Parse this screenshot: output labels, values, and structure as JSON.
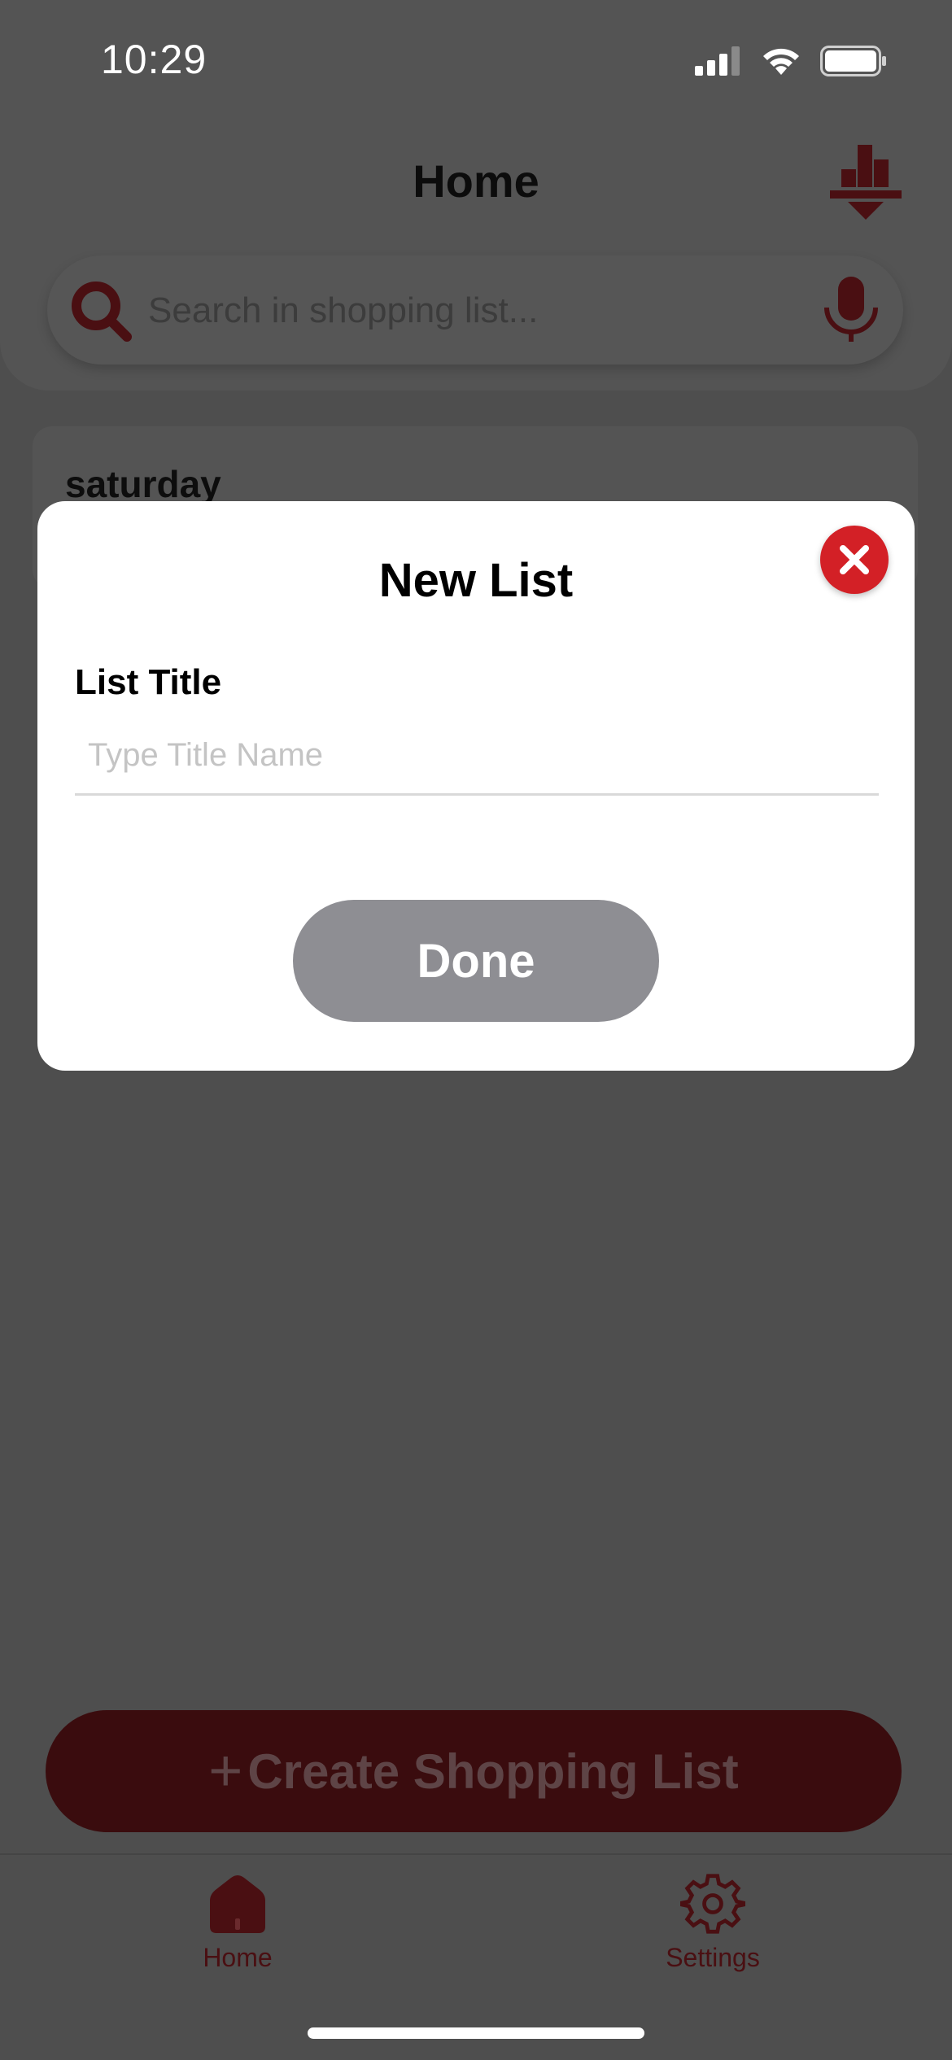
{
  "status_bar": {
    "time": "10:29"
  },
  "header": {
    "title": "Home"
  },
  "search": {
    "placeholder": "Search in shopping list..."
  },
  "lists": [
    {
      "title": "saturday"
    }
  ],
  "modal": {
    "title": "New List",
    "field_label": "List Title",
    "input_placeholder": "Type Title Name",
    "input_value": "",
    "done_label": "Done"
  },
  "create_button": {
    "plus": "+",
    "label": "Create Shopping List"
  },
  "tabs": [
    {
      "label": "Home",
      "icon": "house-icon"
    },
    {
      "label": "Settings",
      "icon": "gear-icon"
    }
  ],
  "colors": {
    "brand_red": "#d32026",
    "dark_red": "#3a0c0e",
    "overlay": "#4e4e4e",
    "done_disabled": "#8e8e93"
  }
}
